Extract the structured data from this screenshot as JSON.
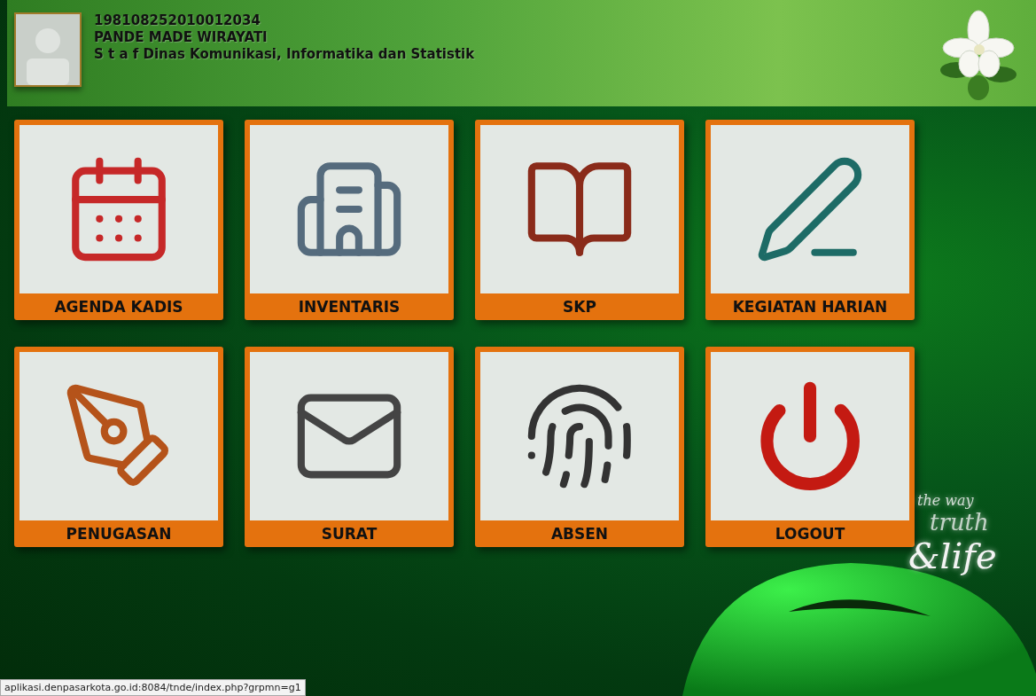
{
  "header": {
    "nip": "198108252010012034",
    "name": "PANDE MADE WIRAYATI",
    "position": "S t a f Dinas Komunikasi, Informatika dan Statistik"
  },
  "menu": [
    {
      "kind": "agenda",
      "label": "AGENDA KADIS"
    },
    {
      "kind": "inventory",
      "label": "INVENTARIS"
    },
    {
      "kind": "skp",
      "label": "SKP"
    },
    {
      "kind": "daily",
      "label": "KEGIATAN HARIAN"
    },
    {
      "kind": "assignment",
      "label": "PENUGASAN"
    },
    {
      "kind": "letter",
      "label": "SURAT"
    },
    {
      "kind": "attendance",
      "label": "ABSEN"
    },
    {
      "kind": "logout",
      "label": "LOGOUT"
    }
  ],
  "slogan": [
    "the way",
    "truth",
    "&life"
  ],
  "status_bar": "aplikasi.denpasarkota.go.id:8084/tnde/index.php?grpmn=g1"
}
